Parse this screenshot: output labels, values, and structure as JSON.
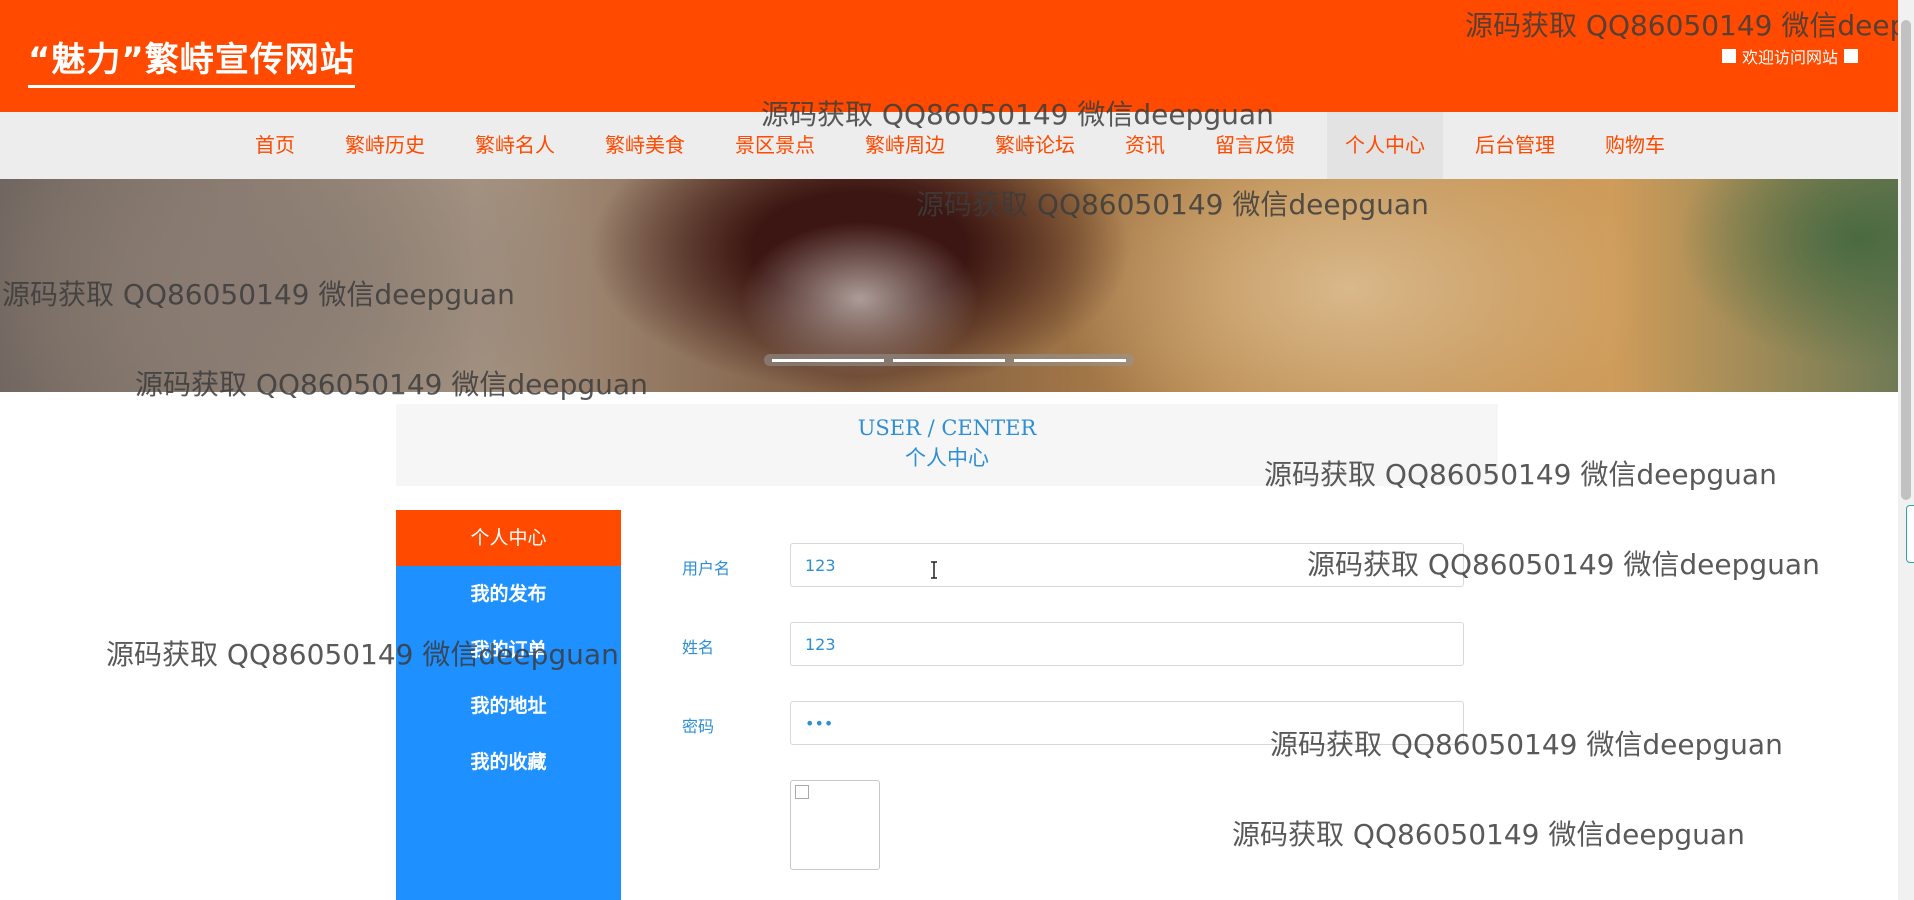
{
  "header": {
    "site_title": "“魅力”繁峙宣传网站",
    "welcome": "欢迎访问网站"
  },
  "nav": {
    "items": [
      {
        "label": "首页"
      },
      {
        "label": "繁峙历史"
      },
      {
        "label": "繁峙名人"
      },
      {
        "label": "繁峙美食"
      },
      {
        "label": "景区景点"
      },
      {
        "label": "繁峙周边"
      },
      {
        "label": "繁峙论坛"
      },
      {
        "label": "资讯"
      },
      {
        "label": "留言反馈"
      },
      {
        "label": "个人中心"
      },
      {
        "label": "后台管理"
      },
      {
        "label": "购物车"
      }
    ],
    "active": "个人中心"
  },
  "banner": {
    "slide_count": 3
  },
  "user_center": {
    "title_en": "USER / CENTER",
    "title_cn": "个人中心"
  },
  "sidebar": {
    "items": [
      {
        "label": "个人中心"
      },
      {
        "label": "我的发布"
      },
      {
        "label": "我的订单"
      },
      {
        "label": "我的地址"
      },
      {
        "label": "我的收藏"
      }
    ],
    "active": "个人中心"
  },
  "form": {
    "username": {
      "label": "用户名",
      "value": "123"
    },
    "name": {
      "label": "姓名",
      "value": "123"
    },
    "password": {
      "label": "密码",
      "value": "123"
    }
  },
  "watermark": {
    "text": "源码获取 QQ86050149 微信deepguan",
    "text_clipped": "源码获取 QQ86050149 微信deep"
  },
  "colors": {
    "primary_orange": "#ff4a00",
    "sidebar_blue": "#1e90ff",
    "text_blue": "#2f8fd4",
    "nav_bg": "#ededed"
  }
}
